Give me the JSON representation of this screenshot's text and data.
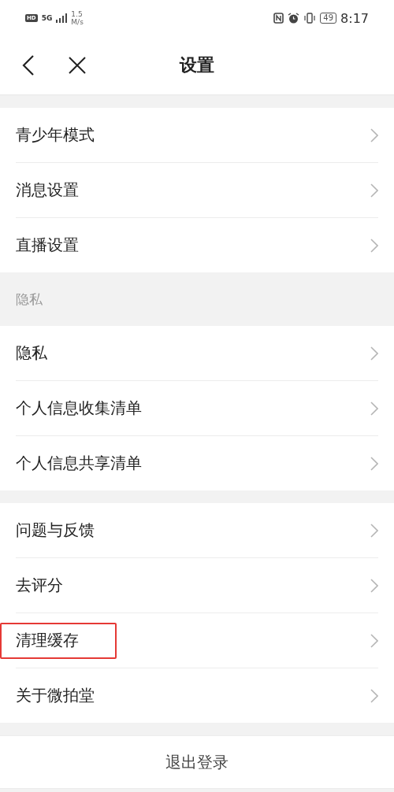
{
  "status_bar": {
    "hd_badge": "HD",
    "network": "5G",
    "speed_value": "1.5",
    "speed_unit": "M/s",
    "battery": "49",
    "time": "8:17"
  },
  "header": {
    "title": "设置"
  },
  "sections": [
    {
      "items": [
        {
          "label": "青少年模式",
          "highlighted": false
        },
        {
          "label": "消息设置",
          "highlighted": false
        },
        {
          "label": "直播设置",
          "highlighted": false
        }
      ]
    },
    {
      "label": "隐私",
      "items": [
        {
          "label": "隐私",
          "highlighted": false
        },
        {
          "label": "个人信息收集清单",
          "highlighted": false
        },
        {
          "label": "个人信息共享清单",
          "highlighted": false
        }
      ]
    },
    {
      "items": [
        {
          "label": "问题与反馈",
          "highlighted": false
        },
        {
          "label": "去评分",
          "highlighted": false
        },
        {
          "label": "清理缓存",
          "highlighted": true
        },
        {
          "label": "关于微拍堂",
          "highlighted": false
        }
      ]
    }
  ],
  "logout": {
    "label": "退出登录"
  }
}
